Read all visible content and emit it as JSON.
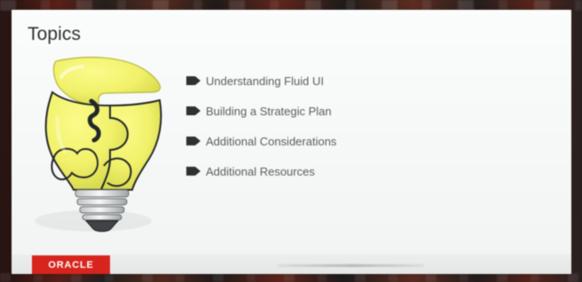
{
  "slide": {
    "title": "Topics",
    "topics": [
      "Understanding Fluid UI",
      "Building a Strategic Plan",
      "Additional Considerations",
      "Additional Resources"
    ],
    "footer": {
      "logo": "ORACLE"
    }
  },
  "icons": {
    "illustration": "puzzle-lightbulb-icon",
    "bullet": "arrow-bullet-icon"
  },
  "colors": {
    "slide_bg": "#f7f8f8",
    "title_text": "#2d3134",
    "topic_text": "#595d60",
    "bullet": "#2e3134",
    "bulb_yellow": "#f1f16b",
    "bulb_outline": "#25282a",
    "oracle_red": "#d7241d"
  }
}
